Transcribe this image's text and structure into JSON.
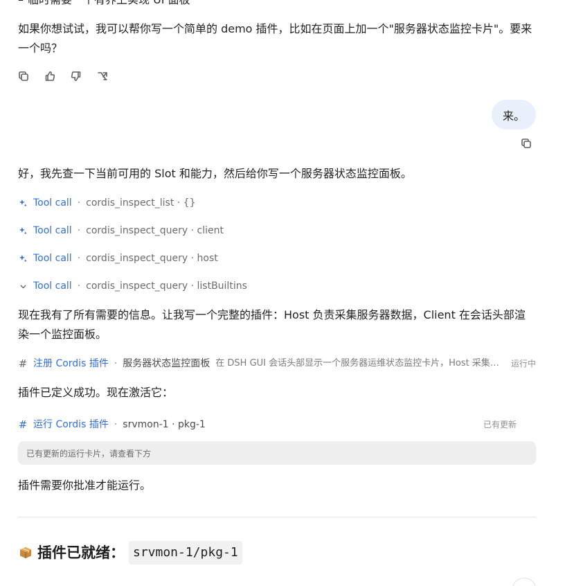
{
  "cut_line": {
    "dash": "–",
    "text": "临时需要一个有界上实现 UI 面板"
  },
  "assistant_intro": "如果你想试试，我可以帮你写一个简单的 demo 插件，比如在页面上加一个\"服务器状态监控卡片\"。要来一个吗？",
  "actions": [
    {
      "icon": "copy-icon"
    },
    {
      "icon": "thumbs-up-icon"
    },
    {
      "icon": "thumbs-down-icon"
    },
    {
      "icon": "branch-icon"
    }
  ],
  "user_message": "来。",
  "assistant_reply": "好，我先查一下当前可用的 Slot 和能力，然后给你写一个服务器状态监控面板。",
  "tool_calls": [
    {
      "icon": "sparkle-icon",
      "label": "Tool call",
      "separator": "·",
      "detail": "cordis_inspect_list · {}"
    },
    {
      "icon": "sparkle-icon",
      "label": "Tool call",
      "separator": "·",
      "detail": "cordis_inspect_query · client"
    },
    {
      "icon": "sparkle-icon",
      "label": "Tool call",
      "separator": "·",
      "detail": "cordis_inspect_query · host"
    },
    {
      "icon": "chevron-down-icon",
      "label": "Tool call",
      "separator": "·",
      "detail": "cordis_inspect_query · listBuiltins"
    }
  ],
  "plan_text": "现在我有了所有需要的信息。让我写一个完整的插件：Host 负责采集服务器数据，Client 在会话头部渲染一个监控面板。",
  "register_plugin": {
    "icon": "#",
    "label": "注册 Cordis 插件",
    "separator": "·",
    "name": "服务器状态监控面板",
    "description": "在 DSH GUI 会话头部显示一个服务器运维状态监控卡片，Host 采集数…",
    "status": "运行中"
  },
  "defined_text": "插件已定义成功。现在激活它：",
  "run_plugin": {
    "icon": "#",
    "label": "运行 Cordis 插件",
    "separator": "·",
    "name": "srvmon-1 · pkg-1",
    "status": "已有更新"
  },
  "run_box_text": "已有更新的运行卡片，请查看下方",
  "approval_text": "插件需要你批准才能运行。",
  "ready_heading": {
    "icon": "package-icon",
    "text": "插件已就绪：",
    "code": "srvmon-1/pkg-1"
  },
  "colors": {
    "link_blue": "#2f6fe0",
    "user_bubble": "#e9f0fb",
    "run_box": "#eeeeef"
  }
}
